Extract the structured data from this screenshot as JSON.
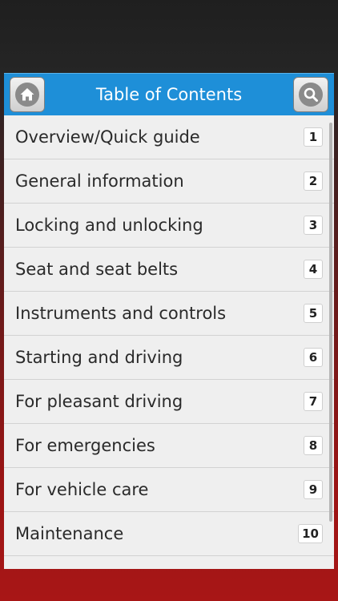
{
  "header": {
    "title": "Table of Contents",
    "home_icon": "home-icon",
    "search_icon": "search-icon",
    "color": "#1e8fd8"
  },
  "toc": [
    {
      "label": "Overview/Quick guide",
      "count": "1"
    },
    {
      "label": "General information",
      "count": "2"
    },
    {
      "label": "Locking and unlocking",
      "count": "3"
    },
    {
      "label": "Seat and seat belts",
      "count": "4"
    },
    {
      "label": "Instruments and controls",
      "count": "5"
    },
    {
      "label": "Starting and driving",
      "count": "6"
    },
    {
      "label": "For pleasant driving",
      "count": "7"
    },
    {
      "label": "For emergencies",
      "count": "8"
    },
    {
      "label": "For vehicle care",
      "count": "9"
    },
    {
      "label": "Maintenance",
      "count": "10"
    }
  ]
}
